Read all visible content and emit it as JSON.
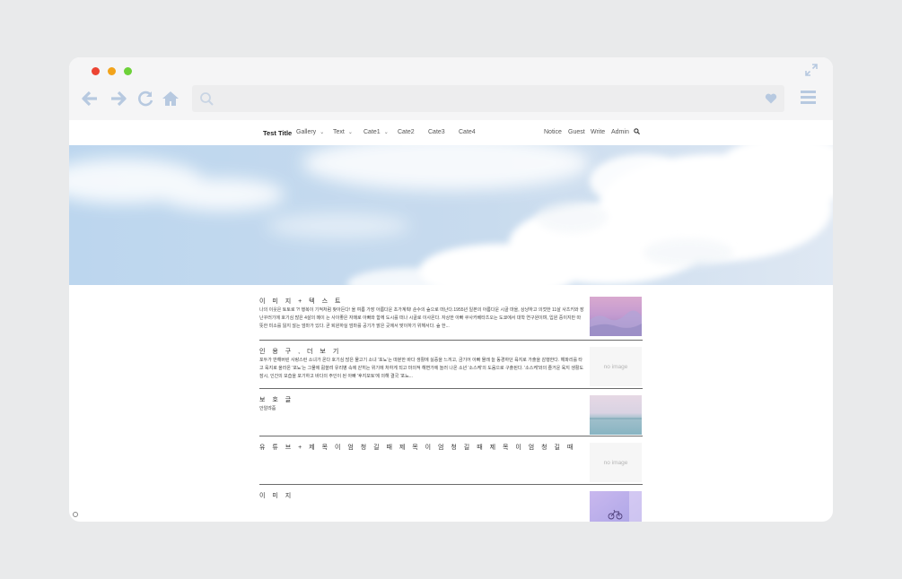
{
  "chrome": {
    "controls": [
      "close",
      "minimize",
      "maximize"
    ],
    "address": {
      "value": "",
      "placeholder": ""
    },
    "icons": [
      "back-arrow-icon",
      "forward-arrow-icon",
      "reload-icon",
      "home-icon",
      "search-icon",
      "heart-icon",
      "hamburger-menu-icon",
      "expand-icon"
    ],
    "accent": "#b7c9e0"
  },
  "nav": {
    "brand": "Test Title",
    "items": [
      {
        "label": "Gallery",
        "dropdown": true
      },
      {
        "label": "Text",
        "dropdown": true
      },
      {
        "label": "Cate1",
        "dropdown": true
      },
      {
        "label": "Cate2",
        "dropdown": false
      },
      {
        "label": "Cate3",
        "dropdown": false
      },
      {
        "label": "Cate4",
        "dropdown": false
      }
    ],
    "right": [
      "Notice",
      "Guest",
      "Write",
      "Admin"
    ]
  },
  "posts": [
    {
      "title": "이 미 지 + 텍 스 트",
      "body": "나의 이웃은 토토로 ?! 행복이 기적처럼 찾아든다! 올 여름 가장 아름다운 초가계획! 순수의 숲으로 떠난다.1955년 일본의 아름다운 시골 마을, 상냥하고 의젓한 11살 사츠키와 장난꾸러기에 호기심 많은 4살의 메이 는 사이좋은 자매로 아빠와 함께 도시를 떠나 시골로 이사온다. 자상한 아빠 쿠사카베타츠오는 도쿄에서 대학 연구원이며, 입원 중이지만 따뜻한 미소를 잃지 않는 엄마가 있다. 곧 퇴원하실 엄마를 공기가 맑은 곳에서 맞이하기 위해서다. 숲 한...",
      "thumb": "image"
    },
    {
      "title": "인 용 구 ,   더 보 기",
      "body": "포두가 반해버린 사랑스런 소녀가 온다 호기심 많은 물고기 소녀 '포뇨'는 따분한 바다 생활에 싫증을 느끼고, 금기어 아빠 몰래 늘 동경하던 육지로 가출을 감행한다. 해파리를 타고 육지로 올라온 '포뇨'는 그물에 휩쓸려 유리병 속에 갇히는 위기에 처하게 되고 마의적 해변가에 놀러 나온 소년 '소스케'의 도움으로 구출된다. '소스케'와의 즐거운 육지 생활도 잠시, 인간의 모습을 포기하고 바다의 주인이 된 아빠 '후지모토'에 의해 결국 '포뇨...",
      "thumb": "no image"
    },
    {
      "title": "보 호 글",
      "body": "안알랴줌",
      "thumb": "image"
    },
    {
      "title": "유 튜 브 + 제 목 이 엄 청 길 때 제 목 이 엄 청 길 때 제 목 이 엄 청 길 때 제 목 이 엄 청 길 때 제 목 이 엄 ...",
      "body": "",
      "thumb": "no image"
    },
    {
      "title": "이 미 지",
      "body": "",
      "thumb": "image"
    }
  ]
}
